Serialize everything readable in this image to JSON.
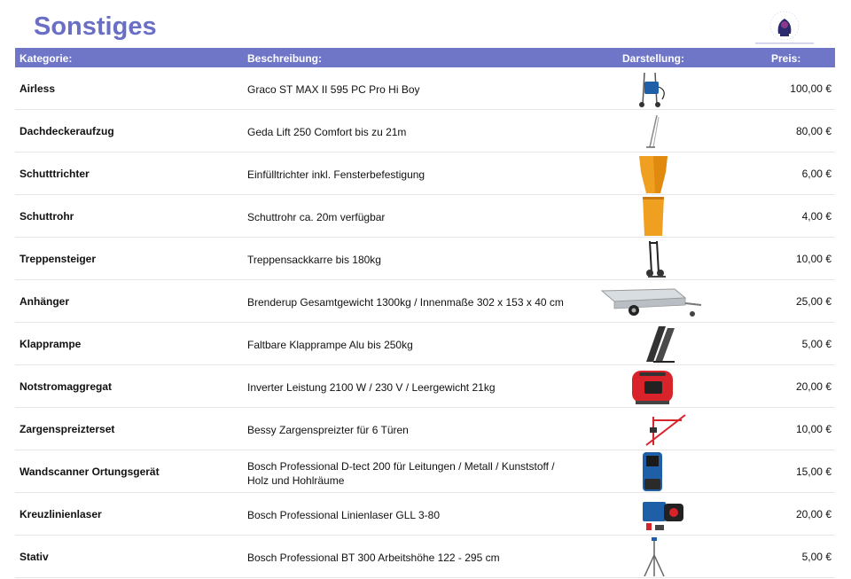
{
  "page": {
    "title": "Sonstiges"
  },
  "table": {
    "headers": {
      "kategorie": "Kategorie:",
      "beschreibung": "Beschreibung:",
      "darstellung": "Darstellung:",
      "preis": "Preis:"
    },
    "rows": [
      {
        "kategorie": "Airless",
        "beschreibung": "Graco ST MAX II 595 PC Pro Hi Boy",
        "preis": "100,00 €",
        "icon": "airless-sprayer-icon"
      },
      {
        "kategorie": "Dachdeckeraufzug",
        "beschreibung": "Geda Lift 250 Comfort bis zu 21m",
        "preis": "80,00 €",
        "icon": "roof-lift-icon"
      },
      {
        "kategorie": "Schutttrichter",
        "beschreibung": "Einfülltrichter inkl. Fensterbefestigung",
        "preis": "6,00 €",
        "icon": "debris-funnel-icon"
      },
      {
        "kategorie": "Schuttrohr",
        "beschreibung": "Schuttrohr ca. 20m verfügbar",
        "preis": "4,00 €",
        "icon": "debris-chute-icon"
      },
      {
        "kategorie": "Treppensteiger",
        "beschreibung": "Treppensackkarre bis 180kg",
        "preis": "10,00 €",
        "icon": "stair-climber-icon"
      },
      {
        "kategorie": "Anhänger",
        "beschreibung": "Brenderup Gesamtgewicht 1300kg / Innenmaße 302 x 153 x 40 cm",
        "preis": "25,00 €",
        "icon": "trailer-icon"
      },
      {
        "kategorie": "Klapprampe",
        "beschreibung": "Faltbare Klapprampe Alu bis 250kg",
        "preis": "5,00 €",
        "icon": "folding-ramp-icon"
      },
      {
        "kategorie": "Notstromaggregat",
        "beschreibung": "Inverter Leistung 2100 W / 230 V / Leergewicht 21kg",
        "preis": "20,00 €",
        "icon": "generator-icon"
      },
      {
        "kategorie": "Zargenspreizterset",
        "beschreibung": "Bessy Zargenspreizter für 6 Türen",
        "preis": "10,00 €",
        "icon": "frame-spreader-icon"
      },
      {
        "kategorie": "Wandscanner Ortungsgerät",
        "beschreibung": "Bosch Professional D-tect 200 für Leitungen / Metall / Kunststoff / Holz und Hohlräume",
        "preis": "15,00 €",
        "icon": "wall-scanner-icon"
      },
      {
        "kategorie": "Kreuzlinienlaser",
        "beschreibung": "Bosch Professional Linienlaser GLL 3-80",
        "preis": "20,00 €",
        "icon": "line-laser-icon"
      },
      {
        "kategorie": "Stativ",
        "beschreibung": "Bosch Professional BT 300 Arbeitshöhe 122 - 295 cm",
        "preis": "5,00 €",
        "icon": "tripod-icon"
      }
    ]
  },
  "colors": {
    "accent": "#6a6fc6",
    "header_bg": "#6f76c8",
    "orange": "#f0a020",
    "red": "#d9232a",
    "blue": "#1f5fa8"
  }
}
